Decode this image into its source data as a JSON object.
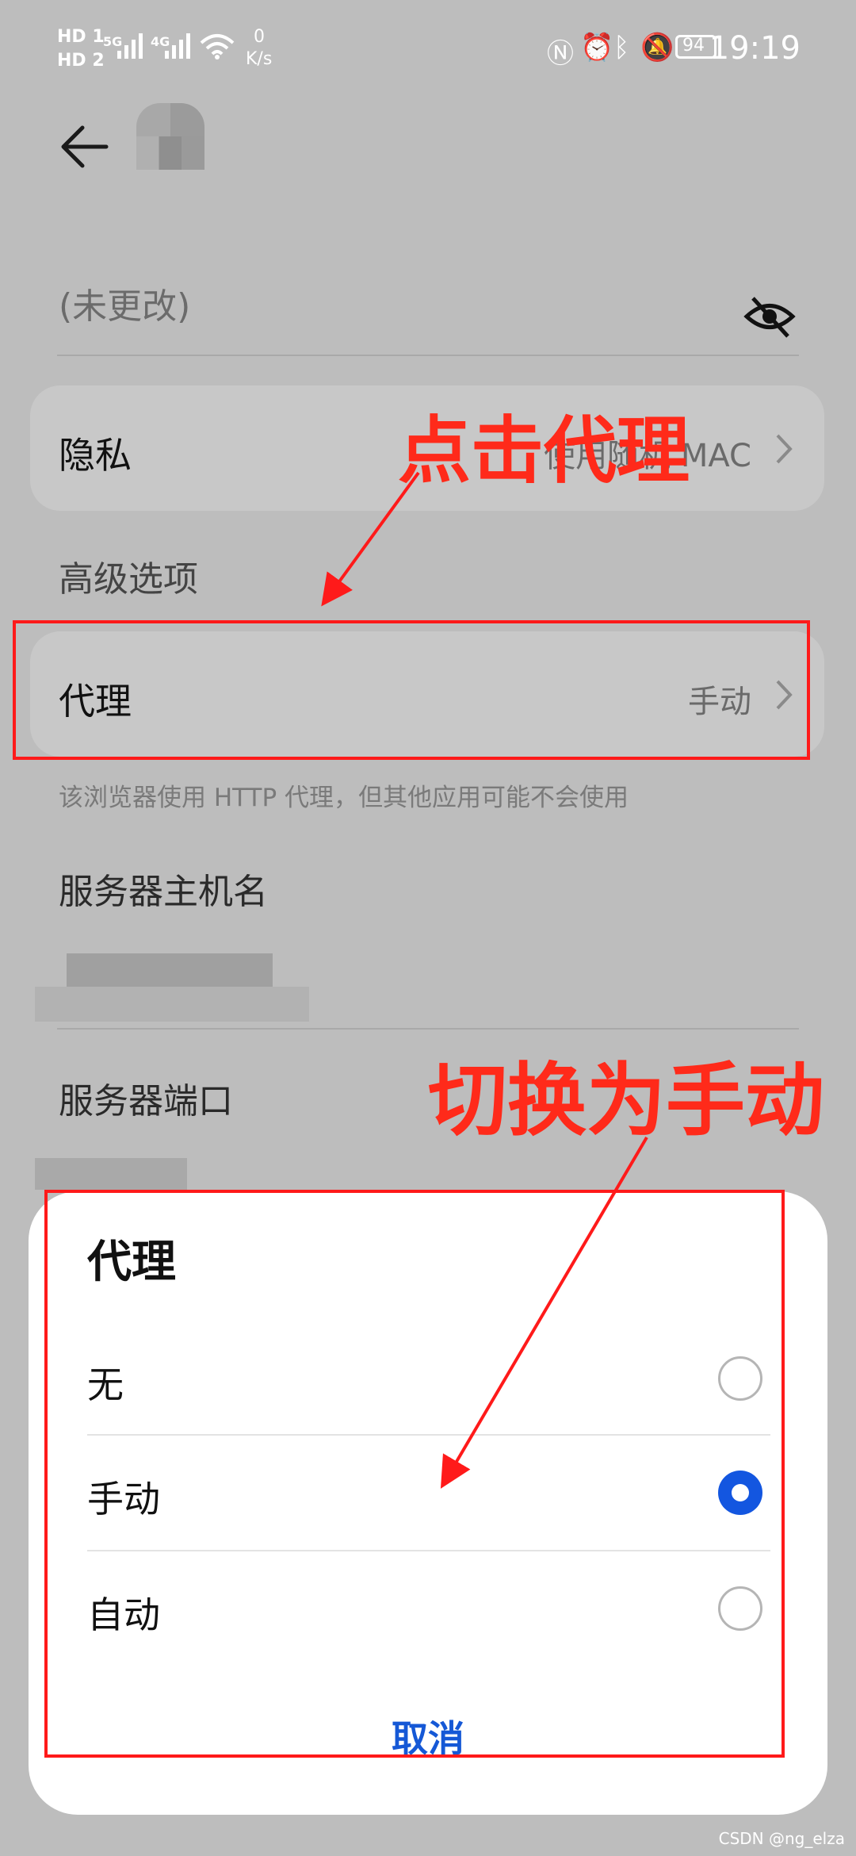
{
  "status_bar": {
    "hd1": "HD 1",
    "hd2": "HD 2",
    "net1": "5G",
    "net2": "4G",
    "speed_value": "0",
    "speed_unit": "K/s",
    "battery": "94",
    "time": "19:19",
    "icons": [
      "nfc-icon",
      "alarm-icon",
      "bluetooth-icon",
      "mute-icon",
      "battery-icon"
    ]
  },
  "header": {
    "back_icon": "back-arrow-icon"
  },
  "password": {
    "placeholder_text": "(未更改)",
    "toggle_icon": "eye-off-icon"
  },
  "privacy": {
    "label": "隐私",
    "value": "使用随机 MAC"
  },
  "advanced": {
    "title": "高级选项"
  },
  "proxy_row": {
    "label": "代理",
    "value": "手动"
  },
  "hint": "该浏览器使用 HTTP 代理，但其他应用可能不会使用",
  "server_host": {
    "label": "服务器主机名"
  },
  "server_port": {
    "label": "服务器端口"
  },
  "annotations": {
    "click_proxy": "点击代理",
    "switch_manual": "切换为手动",
    "color": "#ff1a1a"
  },
  "dialog": {
    "title": "代理",
    "options": [
      {
        "label": "无",
        "selected": false
      },
      {
        "label": "手动",
        "selected": true
      },
      {
        "label": "自动",
        "selected": false
      }
    ],
    "cancel": "取消",
    "accent": "#1356e0"
  },
  "watermark": "CSDN @ng_elza"
}
